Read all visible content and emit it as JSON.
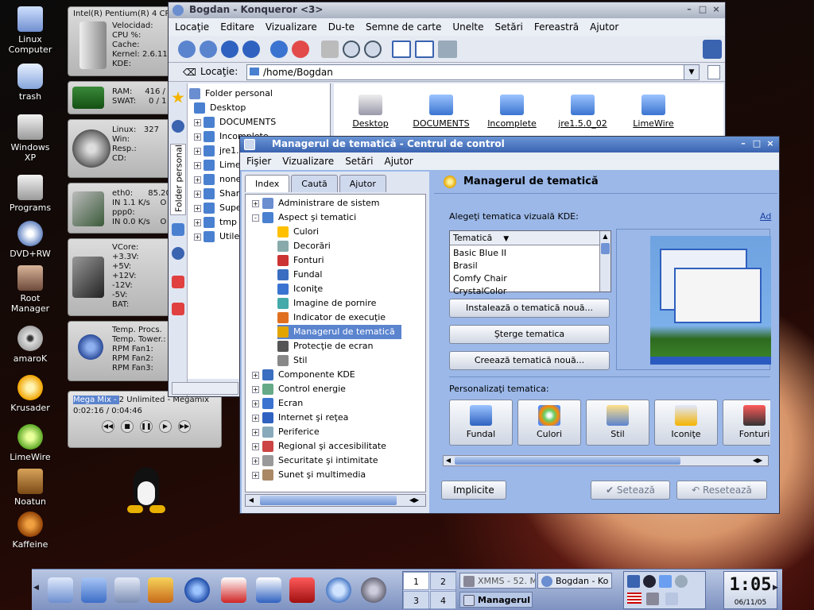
{
  "desktop": {
    "icons": [
      {
        "label": "Linux\nComputer",
        "icon": "computer-icon"
      },
      {
        "label": "trash",
        "icon": "trash-icon"
      },
      {
        "label": "Windows\nXP",
        "icon": "drive-icon"
      },
      {
        "label": "Programs",
        "icon": "drive-icon"
      },
      {
        "label": "DVD+RW",
        "icon": "dvd-icon"
      },
      {
        "label": "Root\nManager",
        "icon": "user-icon"
      },
      {
        "label": "amaroK",
        "icon": "amarok-icon"
      },
      {
        "label": "Krusader",
        "icon": "krusader-icon"
      },
      {
        "label": "LimeWire",
        "icon": "limewire-icon"
      },
      {
        "label": "Noatun",
        "icon": "noatun-icon"
      },
      {
        "label": "Kaffeine",
        "icon": "kaffeine-icon"
      }
    ]
  },
  "monitor": {
    "cpu": {
      "title": "Intel(R) Pentium(R) 4 CP",
      "lines": [
        "Velocidad:",
        "CPU %:",
        "Cache:",
        "Kernel: 2.6.11-ka",
        "KDE:"
      ]
    },
    "ram": {
      "lines": [
        "RAM:     416 /",
        "SWAT:     0 / 1"
      ]
    },
    "disk": {
      "lines": [
        "Linux:   327",
        "Win:",
        "Resp.:",
        "CD:"
      ]
    },
    "net": {
      "lines": [
        "eth0:      85.20",
        "IN 1.1 K/s    O",
        "ppp0:",
        "IN 0.0 K/s    O"
      ]
    },
    "volt": {
      "lines": [
        "VCore:",
        "+3.3V:",
        "+5V:",
        "+12V:",
        "-12V:",
        "-5V:",
        "BAT:"
      ]
    },
    "temp": {
      "lines": [
        "Temp. Procs.",
        "Temp. Tower.:",
        "RPM Fan1:",
        "RPM Fan2:",
        "RPM Fan3:"
      ]
    },
    "player": {
      "title_highlight": "Mega Mix - ",
      "title_rest": "2 Unlimited - Megamix",
      "time": "0:02:16 / 0:04:46"
    }
  },
  "konqueror": {
    "title": "Bogdan - Konqueror <3>",
    "menu": [
      "Locaţie",
      "Editare",
      "Vizualizare",
      "Du-te",
      "Semne de carte",
      "Unelte",
      "Setări",
      "Fereastră",
      "Ajutor"
    ],
    "location_label": "Locaţie:",
    "location_value": "/home/Bogdan",
    "sidebar_tab": "Folder personal",
    "tree": [
      "Folder personal",
      "Desktop",
      "DOCUMENTS",
      "Incomplete",
      "jre1.5",
      "LimeW",
      "none",
      "Share",
      "Supe",
      "tmp",
      "Utile"
    ],
    "files": [
      "Desktop",
      "DOCUMENTS",
      "Incomplete",
      "jre1.5.0_02",
      "LimeWire"
    ]
  },
  "theme_manager": {
    "title": "Managerul de tematică - Centrul de control",
    "menu": [
      "Fişier",
      "Vizualizare",
      "Setări",
      "Ajutor"
    ],
    "tabs": [
      "Index",
      "Caută",
      "Ajutor"
    ],
    "tree": [
      {
        "label": "Administrare de sistem",
        "level": 0,
        "exp": "+"
      },
      {
        "label": "Aspect şi tematici",
        "level": 0,
        "exp": "-"
      },
      {
        "label": "Culori",
        "level": 1
      },
      {
        "label": "Decorări",
        "level": 1
      },
      {
        "label": "Fonturi",
        "level": 1
      },
      {
        "label": "Fundal",
        "level": 1
      },
      {
        "label": "Iconiţe",
        "level": 1
      },
      {
        "label": "Imagine de pornire",
        "level": 1
      },
      {
        "label": "Indicator de execuţie",
        "level": 1
      },
      {
        "label": "Managerul de tematică",
        "level": 1,
        "selected": true
      },
      {
        "label": "Protecţie de ecran",
        "level": 1
      },
      {
        "label": "Stil",
        "level": 1
      },
      {
        "label": "Componente KDE",
        "level": 0,
        "exp": "+"
      },
      {
        "label": "Control energie",
        "level": 0,
        "exp": "+"
      },
      {
        "label": "Ecran",
        "level": 0,
        "exp": "+"
      },
      {
        "label": "Internet şi reţea",
        "level": 0,
        "exp": "+"
      },
      {
        "label": "Periferice",
        "level": 0,
        "exp": "+"
      },
      {
        "label": "Regional şi accesibilitate",
        "level": 0,
        "exp": "+"
      },
      {
        "label": "Securitate şi intimitate",
        "level": 0,
        "exp": "+"
      },
      {
        "label": "Sunet şi multimedia",
        "level": 0,
        "exp": "+"
      }
    ],
    "heading": "Managerul de tematică",
    "choose_label": "Alegeţi tematica vizuală KDE:",
    "choose_link": "Ad",
    "list_header": "Tematică",
    "themes": [
      "Basic Blue II",
      "Brasil",
      "Comfy Chair",
      "CrystalColor"
    ],
    "install_button": "Instalează o tematică nouă...",
    "delete_button": "Şterge tematica",
    "create_button": "Creează tematică nouă...",
    "customize_label": "Personalizaţi tematica:",
    "custom_items": [
      "Fundal",
      "Culori",
      "Stil",
      "Iconiţe",
      "Fonturi"
    ],
    "defaults_button": "Implicite",
    "apply_button": "Setează",
    "reset_button": "Resetează"
  },
  "taskbar": {
    "desktops": [
      "1",
      "2",
      "3",
      "4"
    ],
    "tasks": [
      "XMMS - 52. M",
      "Bogdan - Ko",
      "Managerul"
    ],
    "clock": "1:05",
    "date": "06/11/05"
  }
}
